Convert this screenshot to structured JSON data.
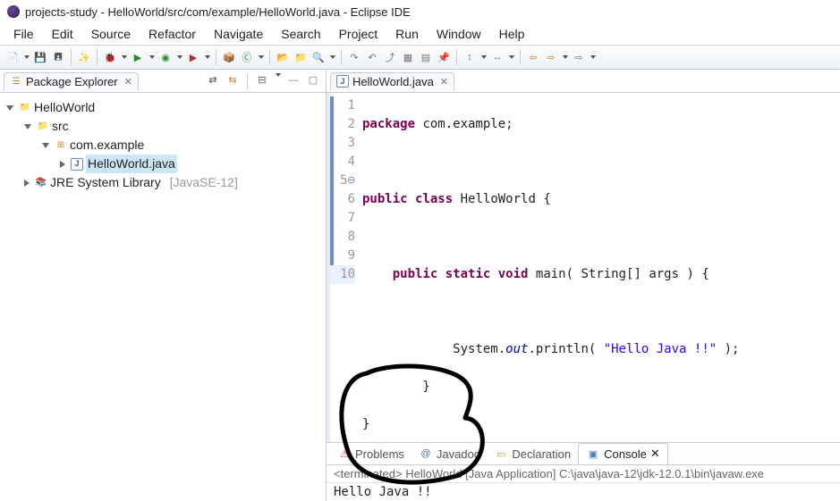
{
  "window_title": "projects-study - HelloWorld/src/com/example/HelloWorld.java - Eclipse IDE",
  "menubar": [
    "File",
    "Edit",
    "Source",
    "Refactor",
    "Navigate",
    "Search",
    "Project",
    "Run",
    "Window",
    "Help"
  ],
  "package_explorer": {
    "tab_label": "Package Explorer",
    "project": "HelloWorld",
    "src_folder": "src",
    "package_name": "com.example",
    "file": "HelloWorld.java",
    "library": "JRE System Library",
    "library_env": "[JavaSE-12]"
  },
  "editor": {
    "tab_label": "HelloWorld.java",
    "lines": {
      "l1": {
        "kw": "package",
        "rest": " com.example;"
      },
      "l3a": "public",
      "l3b": "class",
      "l3c": " HelloWorld {",
      "l5a": "public",
      "l5b": "static",
      "l5c": "void",
      "l5d": " main( String[] args ) {",
      "l7a": "            System.",
      "l7b": "out",
      "l7c": ".println( ",
      "l7d": "\"Hello Java !!\"",
      "l7e": " );",
      "l8": "        }",
      "l9": "}"
    },
    "line_numbers": [
      "1",
      "2",
      "3",
      "4",
      "5",
      "6",
      "7",
      "8",
      "9",
      "10"
    ]
  },
  "bottom_tabs": {
    "problems": "Problems",
    "javadoc": "Javadoc",
    "declaration": "Declaration",
    "console": "Console"
  },
  "console": {
    "header": "<terminated> HelloWorld [Java Application] C:\\java\\java-12\\jdk-12.0.1\\bin\\javaw.exe",
    "output": "Hello Java !!"
  }
}
